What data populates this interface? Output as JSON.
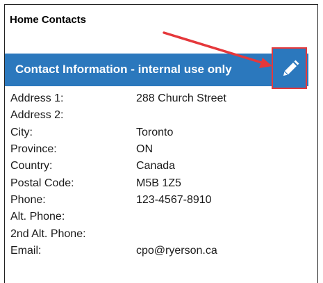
{
  "page": {
    "title": "Home Contacts"
  },
  "section": {
    "title": "Contact Information - internal use only",
    "edit_icon": "pencil-icon",
    "header_color": "#2b78bd",
    "highlight_color": "#e5383b"
  },
  "fields": [
    {
      "label": "Address 1:",
      "value": "288 Church Street"
    },
    {
      "label": "Address 2:",
      "value": ""
    },
    {
      "label": "City:",
      "value": "Toronto"
    },
    {
      "label": "Province:",
      "value": "ON"
    },
    {
      "label": "Country:",
      "value": "Canada"
    },
    {
      "label": "Postal Code:",
      "value": "M5B 1Z5"
    },
    {
      "label": "Phone:",
      "value": "123-4567-8910"
    },
    {
      "label": "Alt. Phone:",
      "value": ""
    },
    {
      "label": "2nd Alt. Phone:",
      "value": ""
    },
    {
      "label": "Email:",
      "value": "cpo@ryerson.ca"
    }
  ]
}
